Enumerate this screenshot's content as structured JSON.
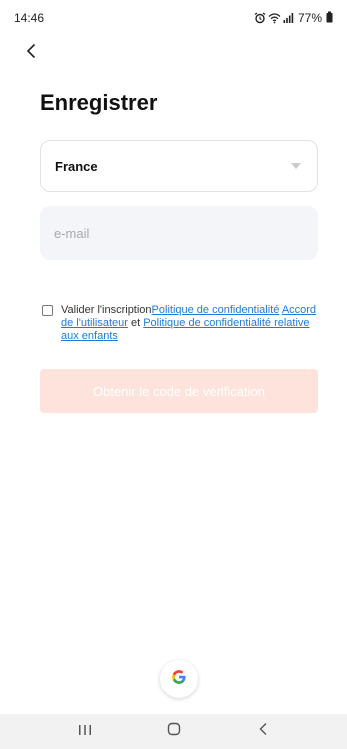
{
  "status_bar": {
    "time": "14:46",
    "battery": "77%",
    "icons": [
      "alarm-icon",
      "wifi-icon",
      "signal-icon",
      "battery-icon"
    ]
  },
  "header": {
    "back_icon": "chevron-left-icon",
    "title": "Enregistrer"
  },
  "form": {
    "country": {
      "value": "France",
      "icon": "caret-down-icon"
    },
    "email": {
      "value": "",
      "placeholder": "e-mail"
    },
    "agreement": {
      "checked": false,
      "prefix": "Valider l'inscription",
      "privacy_link": "Politique de confidentialité",
      "user_agreement_link": "Accord de l'utilisateur",
      "conjunction": " et ",
      "children_privacy_link": "Politique de confidentialité relative aux enfants"
    },
    "submit_label": "Obtenir le code de vérification"
  },
  "social": {
    "google_icon": "google-icon"
  },
  "nav_bar": {
    "icons": [
      "recent-apps-icon",
      "home-icon",
      "back-icon"
    ]
  },
  "colors": {
    "primary_disabled": "#fde3dc",
    "link": "#1f7bd8",
    "input_bg": "#f4f5f9"
  }
}
